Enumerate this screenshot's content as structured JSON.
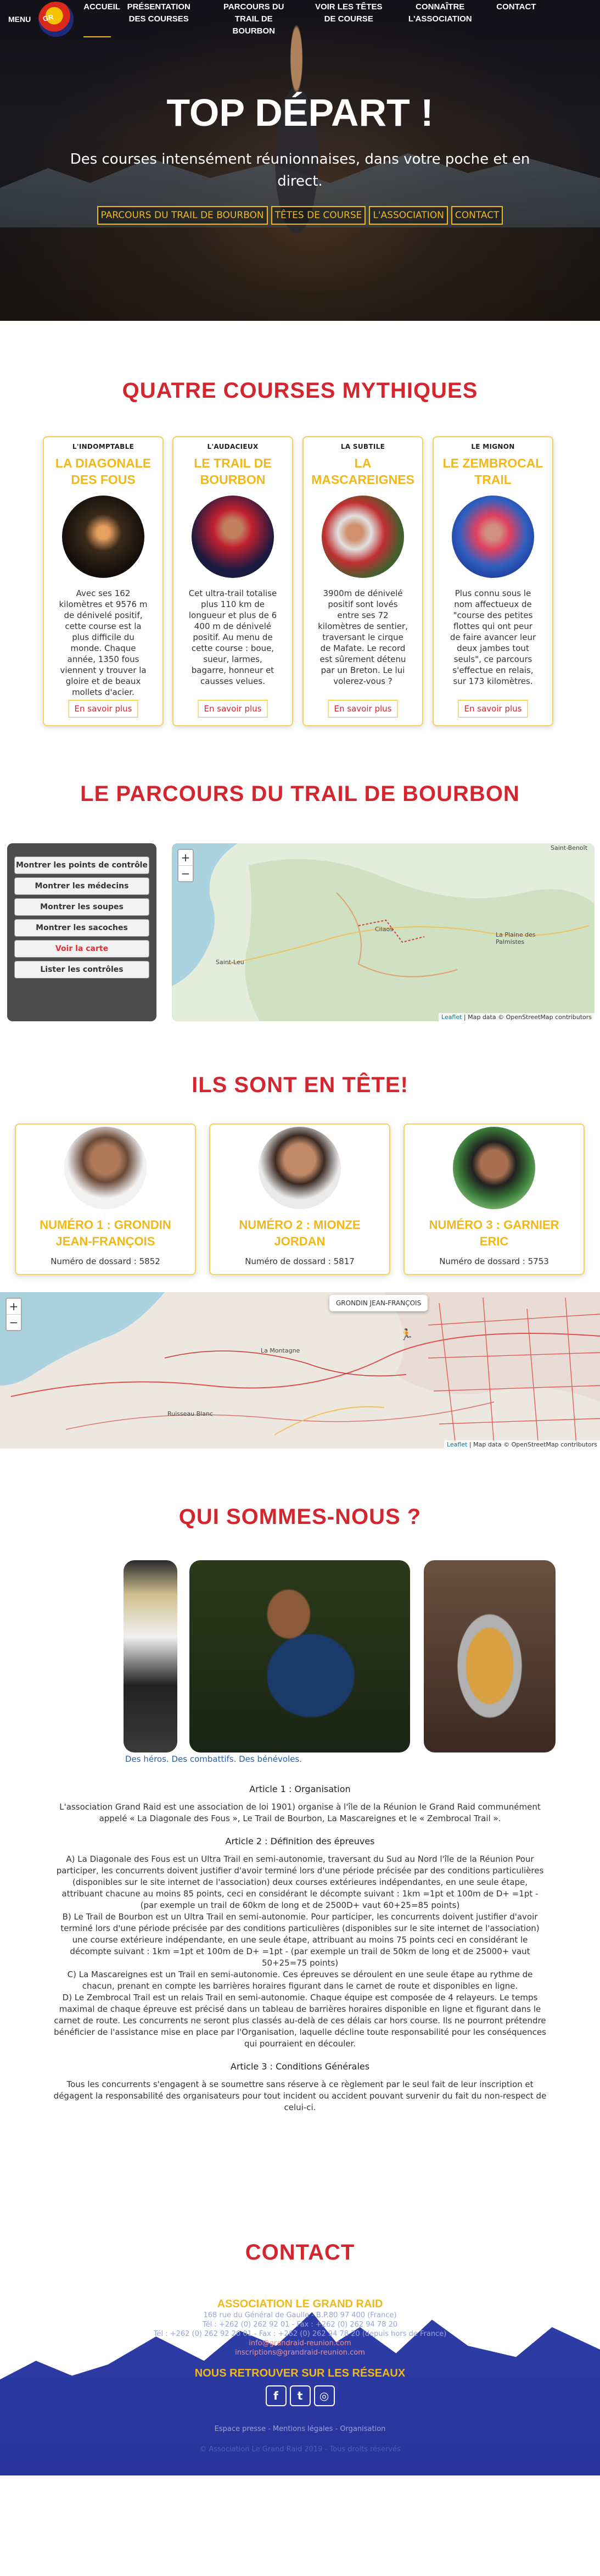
{
  "nav": {
    "menu_label": "MENU",
    "logo_text": "GR",
    "links": [
      {
        "label": "ACCUEIL"
      },
      {
        "label": "PRÉSENTATION DES COURSES"
      },
      {
        "label": "PARCOURS DU TRAIL DE BOURBON"
      },
      {
        "label": "VOIR LES TÊTES DE COURSE"
      },
      {
        "label": "CONNAÎTRE L'ASSOCIATION"
      },
      {
        "label": "CONTACT"
      }
    ]
  },
  "hero": {
    "title": "TOP DÉPART !",
    "subtitle": "Des courses intensément réunionnaises, dans votre poche et en direct.",
    "buttons": [
      "PARCOURS DU TRAIL DE BOURBON",
      "TÊTES DE COURSE",
      "L'ASSOCIATION",
      "CONTACT"
    ]
  },
  "courses": {
    "title": "QUATRE COURSES MYTHIQUES",
    "cards": [
      {
        "kicker": "L'INDOMPTABLE",
        "title": "LA DIAGONALE DES FOUS",
        "description": "Avec ses 162 kilomètres et 9576 m de dénivelé positif, cette course est la plus difficile du monde. Chaque année, 1350 fous viennent y trouver la gloire et de beaux mollets d'acier.",
        "more": "En savoir plus"
      },
      {
        "kicker": "L'AUDACIEUX",
        "title": "LE TRAIL DE BOURBON",
        "description": "Cet ultra-trail totalise plus 110 km de longueur et plus de 6 400 m de dénivelé positif. Au menu de cette course : boue, sueur, larmes, bagarre, honneur et causses velues.",
        "more": "En savoir plus"
      },
      {
        "kicker": "LA SUBTILE",
        "title": "LA MASCAREIGNES",
        "description": "3900m de dénivelé positif sont lovés entre ses 72 kilomètres de sentier, traversant le cirque de Mafate. Le record est sûrement détenu par un Breton. Le lui volerez-vous ?",
        "more": "En savoir plus"
      },
      {
        "kicker": "LE MIGNON",
        "title": "LE ZEMBROCAL TRAIL",
        "description": "Plus connu sous le nom affectueux de \"course des petites flottes qui ont peur de faire avancer leur deux jambes tout seuls\", ce parcours s'effectue en relais, sur 173 kilomètres.",
        "more": "En savoir plus"
      }
    ]
  },
  "parcours": {
    "title": "LE PARCOURS DU TRAIL DE BOURBON",
    "controls": [
      "Montrer les points de contrôle",
      "Montrer les médecins",
      "Montrer les soupes",
      "Montrer les sacoches",
      "Voir la carte",
      "Lister les contrôles"
    ],
    "map_labels": [
      "Saint-Benoît",
      "Cilaos",
      "La Plaine des Palmistes",
      "Saint-Leu"
    ],
    "zoom_in": "+",
    "zoom_out": "−",
    "attribution_prefix": "Leaflet",
    "attribution_text": " | Map data © OpenStreetMap contributors"
  },
  "leaders": {
    "title": "ILS SONT EN TÊTE!",
    "runners": [
      {
        "name": "NUMÉRO 1 : GRONDIN JEAN-FRANÇOIS",
        "bib": "Numéro de dossard : 5852"
      },
      {
        "name": "NUMÉRO 2 : MIONZE JORDAN",
        "bib": "Numéro de dossard : 5817"
      },
      {
        "name": "NUMÉRO 3 : GARNIER ERIC",
        "bib": "Numéro de dossard : 5753"
      }
    ],
    "map_tooltip": "GRONDIN JEAN-FRANÇOIS",
    "map_labels": [
      "La Montagne",
      "Ruisseau Blanc"
    ],
    "zoom_in": "+",
    "zoom_out": "−",
    "attribution_prefix": "Leaflet",
    "attribution_text": " | Map data © OpenStreetMap contributors"
  },
  "qui": {
    "title": "QUI SOMMES-NOUS ?",
    "caption": "Des héros. Des combattifs. Des bénévoles.",
    "article1_title": "Article 1 : Organisation",
    "article1_text": "L'association Grand Raid est une association de loi 1901) organise à l'île de la Réunion le Grand Raid communément appelé « La Diagonale des Fous », Le Trail de Bourbon, La Mascareignes et le « Zembrocal Trail ».",
    "article2_title": "Article 2 : Définition des épreuves",
    "article2_a": "A) La Diagonale des Fous est un Ultra Trail en semi-autonomie, traversant du Sud au Nord l'île de la Réunion Pour participer, les concurrents doivent justifier d'avoir terminé lors d'une période précisée par des conditions particulières (disponibles sur le site internet de l'association) deux courses extérieures indépendantes, en une seule étape, attribuant chacune au moins 85 points, ceci en considérant le décompte suivant : 1km =1pt et 100m de D+ =1pt - (par exemple un trail de 60km de long et de 2500D+ vaut 60+25=85 points)",
    "article2_b": "B) Le Trail de Bourbon est un Ultra Trail en semi-autonomie. Pour participer, les concurrents doivent justifier d'avoir terminé lors d'une période précisée par des conditions particulières (disponibles sur le site internet de l'association) une course extérieure indépendante, en une seule étape, attribuant au moins 75 points ceci en considérant le décompte suivant : 1km =1pt et 100m de D+ =1pt - (par exemple un trail de 50km de long et de 25000+ vaut 50+25=75 points)",
    "article2_c": "C) La Mascareignes est un Trail en semi-autonomie. Ces épreuves se déroulent en une seule étape au rythme de chacun, prenant en compte les barrières horaires figurant dans le carnet de route et disponibles en ligne.",
    "article2_d": "D) Le Zembrocal Trail est un relais Trail en semi-autonomie. Chaque équipe est composée de 4 relayeurs. Le temps maximal de chaque épreuve est précisé dans un tableau de barrières horaires disponible en ligne et figurant dans le carnet de route. Les concurrents ne seront plus classés au-delà de ces délais car hors course. Ils ne pourront prétendre bénéficier de l'assistance mise en place par l'Organisation, laquelle décline toute responsabilité pour les conséquences qui pourraient en découler.",
    "article3_title": "Article 3 : Conditions Générales",
    "article3_text": "Tous les concurrents s'engagent à se soumettre sans réserve à ce règlement par le seul fait de leur inscription et dégagent la responsabilité des organisateurs pour tout incident ou accident pouvant survenir du fait du non-respect de celui-ci."
  },
  "contact": {
    "title": "CONTACT",
    "org": "ASSOCIATION LE GRAND RAID",
    "address": "168 rue du Général de Gaulle - B.P.80 97 400 (France)",
    "phone1": "Tél : +262 (0) 262 92 01 - Fax : +262 (0) 262 94 78 20",
    "phone2": "Tél : +262 (0) 262 92 20 01 - Fax : +262 (0) 262 94 78 20 (depuis hors de France)",
    "email1": "info@grandraid-reunion.com",
    "email2": "inscriptions@grandraid-reunion.com",
    "social_title": "NOUS RETROUVER SUR LES RÉSEAUX",
    "social_icons": [
      "f",
      "t",
      "◎"
    ],
    "legal": "Espace presse - Mentions légales - Organisation",
    "copyright": "© Association Le Grand Raid 2019 - Tous droits réservés"
  }
}
